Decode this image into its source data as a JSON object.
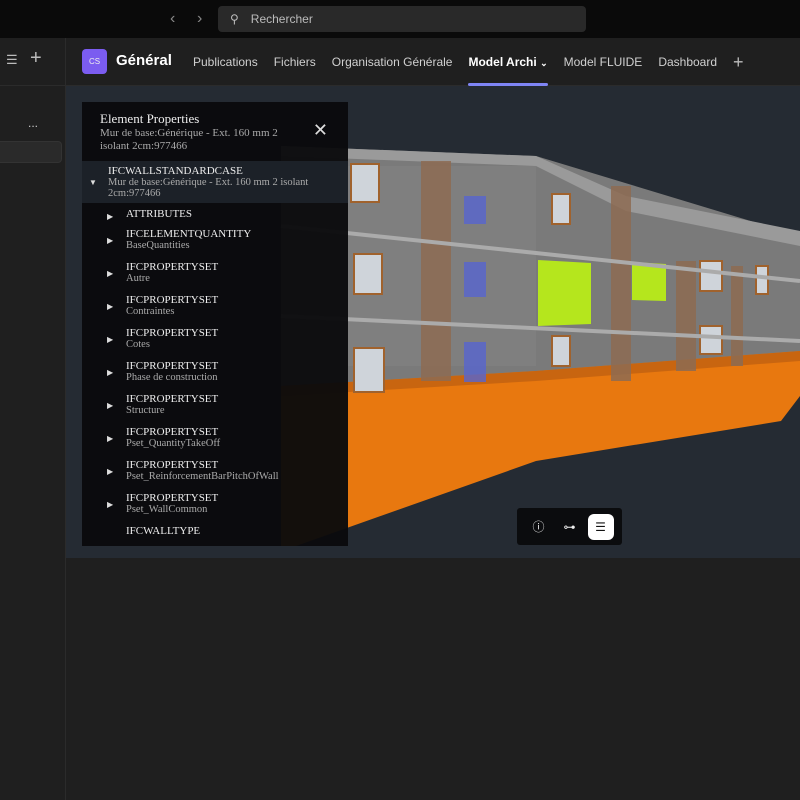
{
  "topbar": {
    "search_placeholder": "Rechercher",
    "back_icon": "chevron-left-icon",
    "forward_icon": "chevron-right-icon"
  },
  "left": {
    "more": "..."
  },
  "header": {
    "avatar": "CS",
    "title": "Général",
    "tabs": [
      {
        "label": "Publications"
      },
      {
        "label": "Fichiers"
      },
      {
        "label": "Organisation Générale"
      },
      {
        "label": "Model Archi",
        "active": true
      },
      {
        "label": "Model FLUIDE"
      },
      {
        "label": "Dashboard"
      }
    ],
    "add": "+"
  },
  "panel": {
    "title": "Element Properties",
    "subtitle": "Mur de base:Générique - Ext. 160 mm 2 isolant 2cm:977466",
    "close": "✕",
    "root": {
      "name": "IFCWALLSTANDARDCASE",
      "desc": "Mur de base:Générique - Ext. 160 mm 2 isolant 2cm:977466"
    },
    "items": [
      {
        "name": "ATTRIBUTES",
        "desc": ""
      },
      {
        "name": "IFCELEMENTQUANTITY",
        "desc": "BaseQuantities"
      },
      {
        "name": "IFCPROPERTYSET",
        "desc": "Autre"
      },
      {
        "name": "IFCPROPERTYSET",
        "desc": "Contraintes"
      },
      {
        "name": "IFCPROPERTYSET",
        "desc": "Cotes"
      },
      {
        "name": "IFCPROPERTYSET",
        "desc": "Phase de construction"
      },
      {
        "name": "IFCPROPERTYSET",
        "desc": "Structure"
      },
      {
        "name": "IFCPROPERTYSET",
        "desc": "Pset_QuantityTakeOff"
      },
      {
        "name": "IFCPROPERTYSET",
        "desc": "Pset_ReinforcementBarPitchOfWall"
      },
      {
        "name": "IFCPROPERTYSET",
        "desc": "Pset_WallCommon"
      }
    ],
    "last": "IFCWALLTYPE"
  },
  "toolbar": {
    "buttons": [
      {
        "icon": "info-icon"
      },
      {
        "icon": "tree-icon"
      },
      {
        "icon": "list-icon",
        "active": true
      }
    ]
  },
  "colors": {
    "accent": "#7f85f5",
    "avatar": "#7b5cf0",
    "facade_orange": "#e8780f",
    "selected_green": "#b5e61d"
  }
}
